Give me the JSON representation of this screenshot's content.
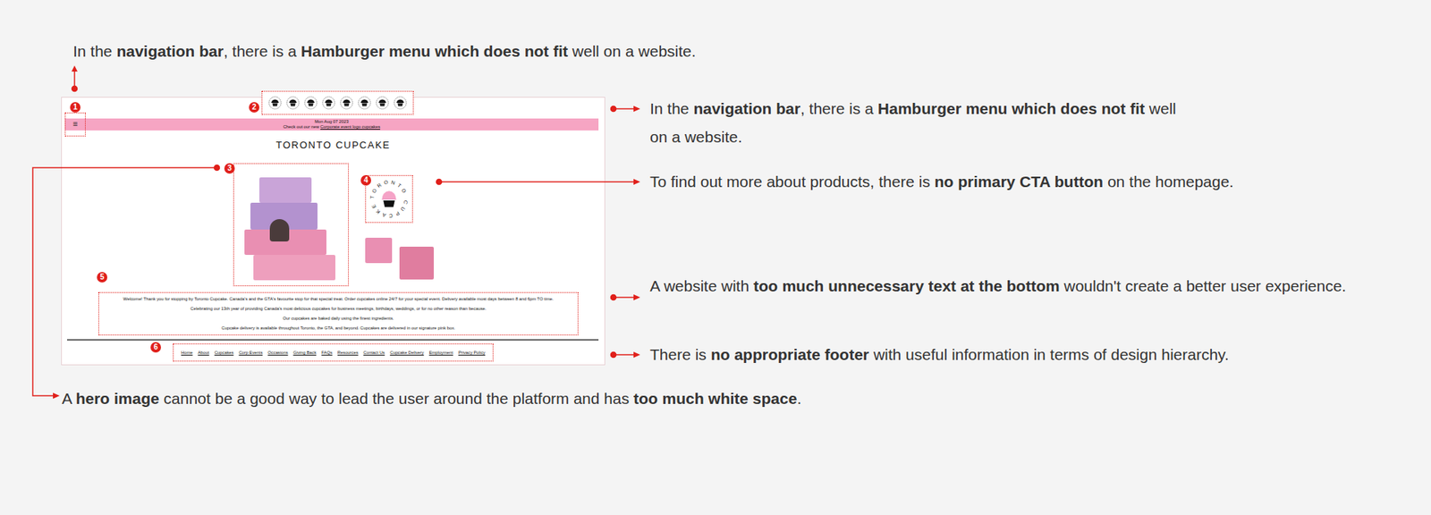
{
  "top_note": {
    "lines": [
      [
        {
          "text": "In the ",
          "bold": false
        },
        {
          "text": "navigation bar",
          "bold": true
        },
        {
          "text": ", there is a ",
          "bold": false
        },
        {
          "text": "Hamburger menu which does not fit",
          "bold": true
        },
        {
          "text": " well on a website.",
          "bold": false
        }
      ]
    ]
  },
  "side_notes": [
    {
      "lines": [
        [
          {
            "text": "In the ",
            "bold": false
          },
          {
            "text": "navigation bar",
            "bold": true
          },
          {
            "text": ", there is a ",
            "bold": false
          },
          {
            "text": "Hamburger menu which does not fit",
            "bold": true
          },
          {
            "text": " well",
            "bold": false
          }
        ],
        [
          {
            "text": "on a website.",
            "bold": false
          }
        ]
      ]
    },
    {
      "lines": [
        [
          {
            "text": "To find out more about products, there is ",
            "bold": false
          },
          {
            "text": "no primary CTA button",
            "bold": true
          },
          {
            "text": " on the homepage.",
            "bold": false
          }
        ]
      ]
    },
    {
      "lines": [
        [
          {
            "text": "A website with ",
            "bold": false
          },
          {
            "text": "too much unnecessary text at the bottom",
            "bold": true
          },
          {
            "text": " wouldn't create a better user experience.",
            "bold": false
          }
        ]
      ]
    },
    {
      "lines": [
        [
          {
            "text": "There is ",
            "bold": false
          },
          {
            "text": "no appropriate footer",
            "bold": true
          },
          {
            "text": " with useful information in terms of design hierarchy.",
            "bold": false
          }
        ]
      ]
    }
  ],
  "bottom_note": {
    "lines": [
      [
        {
          "text": "A ",
          "bold": false
        },
        {
          "text": "hero image",
          "bold": true
        },
        {
          "text": " cannot be a good way to lead the user around the platform and has ",
          "bold": false
        },
        {
          "text": "too much white space",
          "bold": true
        },
        {
          "text": ".",
          "bold": false
        }
      ]
    ]
  },
  "markers": [
    "1",
    "2",
    "3",
    "4",
    "5",
    "6"
  ],
  "site": {
    "menu_icon": "≡",
    "date": "Mon Aug 07 2023",
    "promo_prefix": "Check out our new ",
    "promo_link": "Corporate event logo cupcakes",
    "title": "TORONTO CUPCAKE",
    "logo_text": "TORONTO CUPCAKE",
    "paragraphs": [
      "Welcome! Thank you for stopping by Toronto Cupcake. Canada's and the GTA's favourite stop for that special treat. Order cupcakes online 24/7 for your special event. Delivery available most days between 8 and 6pm TO time.",
      "Celebrating our 13th year of providing Canada's most delicious cupcakes for business meetings, birthdays, weddings, or for no other reason than because.",
      "Our cupcakes are baked daily using the finest ingredients.",
      "Cupcake delivery is available throughout Toronto, the GTA, and beyond. Cupcakes are delivered in our signature pink box."
    ],
    "footer_links": [
      "Home",
      "About",
      "Cupcakes",
      "Corp Events",
      "Occasions",
      "Giving Back",
      "FAQs",
      "Resources",
      "Contact Us",
      "Cupcake Delivery",
      "Employment",
      "Privacy Policy"
    ]
  }
}
